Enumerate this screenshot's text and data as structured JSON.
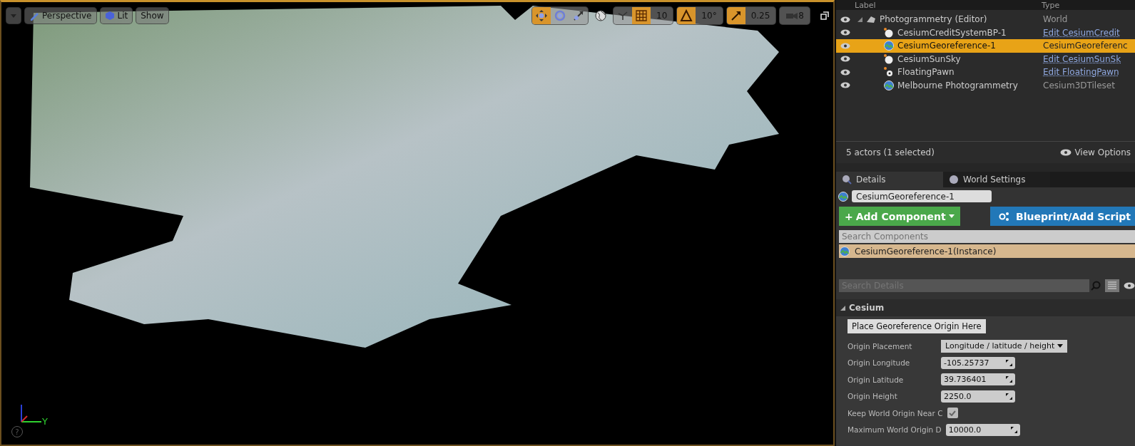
{
  "viewport": {
    "view_menu": {
      "label": "Perspective"
    },
    "lit_menu": {
      "label": "Lit"
    },
    "show_menu": {
      "label": "Show"
    },
    "transform_tools": [
      {
        "kind": "move",
        "selected": true
      },
      {
        "kind": "rotate",
        "selected": false
      },
      {
        "kind": "scale",
        "selected": false
      }
    ],
    "snaps": [
      {
        "kind": "grid",
        "on": true,
        "value": "10"
      },
      {
        "kind": "angle",
        "on": true,
        "value": "10°"
      },
      {
        "kind": "scale",
        "on": true,
        "value": "0.25"
      }
    ],
    "camera_speed": "8",
    "axis_label": "Y",
    "help": "?"
  },
  "outliner": {
    "columns": [
      "Label",
      "Type"
    ],
    "items": [
      {
        "label": "Photogrammetry (Editor)",
        "type": "World",
        "type_link": false,
        "kind": "world",
        "selected": false,
        "expanded": true,
        "children": [
          {
            "label": "CesiumCreditSystemBP-1",
            "type": "Edit CesiumCredit",
            "type_link": true,
            "kind": "ball",
            "selected": false
          },
          {
            "label": "CesiumGeoreference-1",
            "type": "CesiumGeoreferenc",
            "type_link": false,
            "kind": "globe",
            "selected": true
          },
          {
            "label": "CesiumSunSky",
            "type": "Edit CesiumSunSk",
            "type_link": true,
            "kind": "ball",
            "selected": false
          },
          {
            "label": "FloatingPawn",
            "type": "Edit FloatingPawn",
            "type_link": true,
            "kind": "pawn",
            "selected": false
          },
          {
            "label": "Melbourne Photogrammetry",
            "type": "Cesium3DTileset",
            "type_link": false,
            "kind": "globe",
            "selected": false
          }
        ]
      }
    ],
    "status": "5 actors (1 selected)",
    "view_options": "View Options"
  },
  "details": {
    "tabs": [
      {
        "label": "Details",
        "selected": true
      },
      {
        "label": "World Settings",
        "selected": false
      }
    ],
    "name_value": "CesiumGeoreference-1",
    "add_component": {
      "plus": "+",
      "label": "Add Component"
    },
    "blueprint": "Blueprint/Add Script",
    "component_search": {
      "placeholder": "Search Components"
    },
    "components": [
      {
        "label": "CesiumGeoreference-1(Instance)",
        "selected": true
      }
    ],
    "details_search": {
      "placeholder": "Search Details"
    },
    "category": {
      "label": "Cesium",
      "expanded": true
    },
    "action_button": "Place Georeference Origin Here",
    "properties": [
      {
        "kind": "dropdown",
        "label": "Origin Placement",
        "value": "Longitude / latitude / height"
      },
      {
        "kind": "number",
        "label": "Origin Longitude",
        "value": "-105.25737"
      },
      {
        "kind": "number",
        "label": "Origin Latitude",
        "value": "39.736401"
      },
      {
        "kind": "number",
        "label": "Origin Height",
        "value": "2250.0"
      },
      {
        "kind": "checkbox",
        "label": "Keep World Origin Near C",
        "checked": true
      },
      {
        "kind": "number",
        "label": "Maximum World Origin D",
        "value": "10000.0"
      }
    ]
  }
}
